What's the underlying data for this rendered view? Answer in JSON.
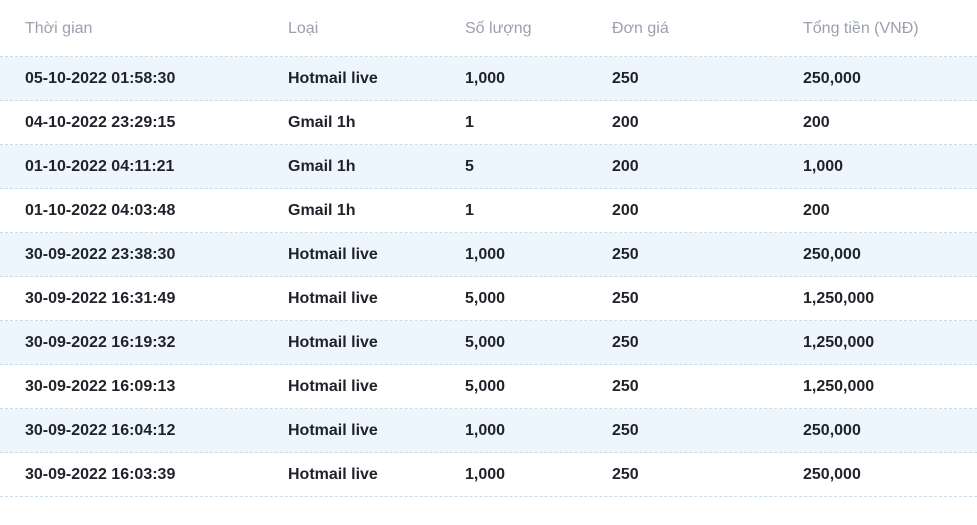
{
  "table": {
    "headers": [
      "Thời gian",
      "Loại",
      "Số lượng",
      "Đơn giá",
      "Tổng tiền (VNĐ)"
    ],
    "rows": [
      {
        "time": "05-10-2022 01:58:30",
        "type": "Hotmail live",
        "qty": "1,000",
        "price": "250",
        "total": "250,000",
        "highlight": true
      },
      {
        "time": "04-10-2022 23:29:15",
        "type": "Gmail 1h",
        "qty": "1",
        "price": "200",
        "total": "200",
        "highlight": false
      },
      {
        "time": "01-10-2022 04:11:21",
        "type": "Gmail 1h",
        "qty": "5",
        "price": "200",
        "total": "1,000",
        "highlight": true
      },
      {
        "time": "01-10-2022 04:03:48",
        "type": "Gmail 1h",
        "qty": "1",
        "price": "200",
        "total": "200",
        "highlight": false
      },
      {
        "time": "30-09-2022 23:38:30",
        "type": "Hotmail live",
        "qty": "1,000",
        "price": "250",
        "total": "250,000",
        "highlight": true
      },
      {
        "time": "30-09-2022 16:31:49",
        "type": "Hotmail live",
        "qty": "5,000",
        "price": "250",
        "total": "1,250,000",
        "highlight": false
      },
      {
        "time": "30-09-2022 16:19:32",
        "type": "Hotmail live",
        "qty": "5,000",
        "price": "250",
        "total": "1,250,000",
        "highlight": true
      },
      {
        "time": "30-09-2022 16:09:13",
        "type": "Hotmail live",
        "qty": "5,000",
        "price": "250",
        "total": "1,250,000",
        "highlight": false
      },
      {
        "time": "30-09-2022 16:04:12",
        "type": "Hotmail live",
        "qty": "1,000",
        "price": "250",
        "total": "250,000",
        "highlight": true
      },
      {
        "time": "30-09-2022 16:03:39",
        "type": "Hotmail live",
        "qty": "1,000",
        "price": "250",
        "total": "250,000",
        "highlight": false
      }
    ]
  },
  "colors": {
    "header_text": "#9aa0ac",
    "cell_text": "#1f2329",
    "row_highlight": "#eef6fd",
    "divider": "#c9dcea"
  }
}
